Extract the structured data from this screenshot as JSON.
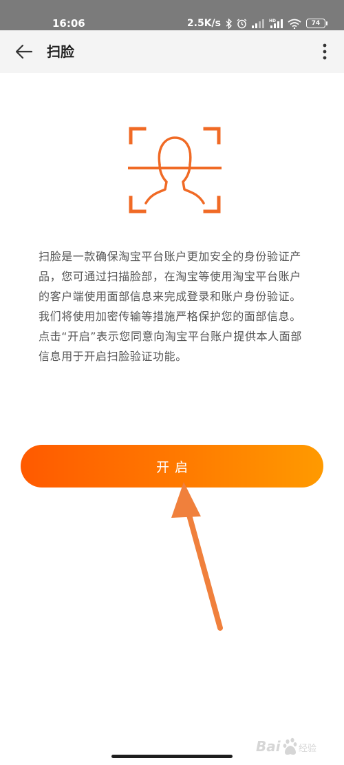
{
  "status_bar": {
    "time": "16:06",
    "net_speed": "2.5K/s",
    "battery_level": "74"
  },
  "header": {
    "title": "扫脸"
  },
  "description": {
    "paragraph1": "扫脸是一款确保淘宝平台账户更加安全的身份验证产品，您可通过扫描脸部，在淘宝等使用淘宝平台账户的客户端使用面部信息来完成登录和账户身份验证。我们将使用加密传输等措施严格保护您的面部信息。",
    "paragraph2": "点击“开启”表示您同意向淘宝平台账户提供本人面部信息用于开启扫脸验证功能。"
  },
  "actions": {
    "open_label": "开启"
  },
  "watermark": {
    "text": "Baidu经验"
  },
  "colors": {
    "accent": "#ff6a00",
    "face_icon": "#f06a25",
    "arrow": "#f0803c",
    "status_bar_bg": "#7b7b7b",
    "header_bg": "#f4f4f4"
  },
  "icons": {
    "back": "back-arrow-icon",
    "more": "more-vertical-icon",
    "face_scan": "face-scan-icon",
    "bluetooth": "bluetooth-icon",
    "alarm": "alarm-icon",
    "signal": "signal-icon",
    "wifi": "wifi-icon",
    "battery": "battery-icon"
  }
}
